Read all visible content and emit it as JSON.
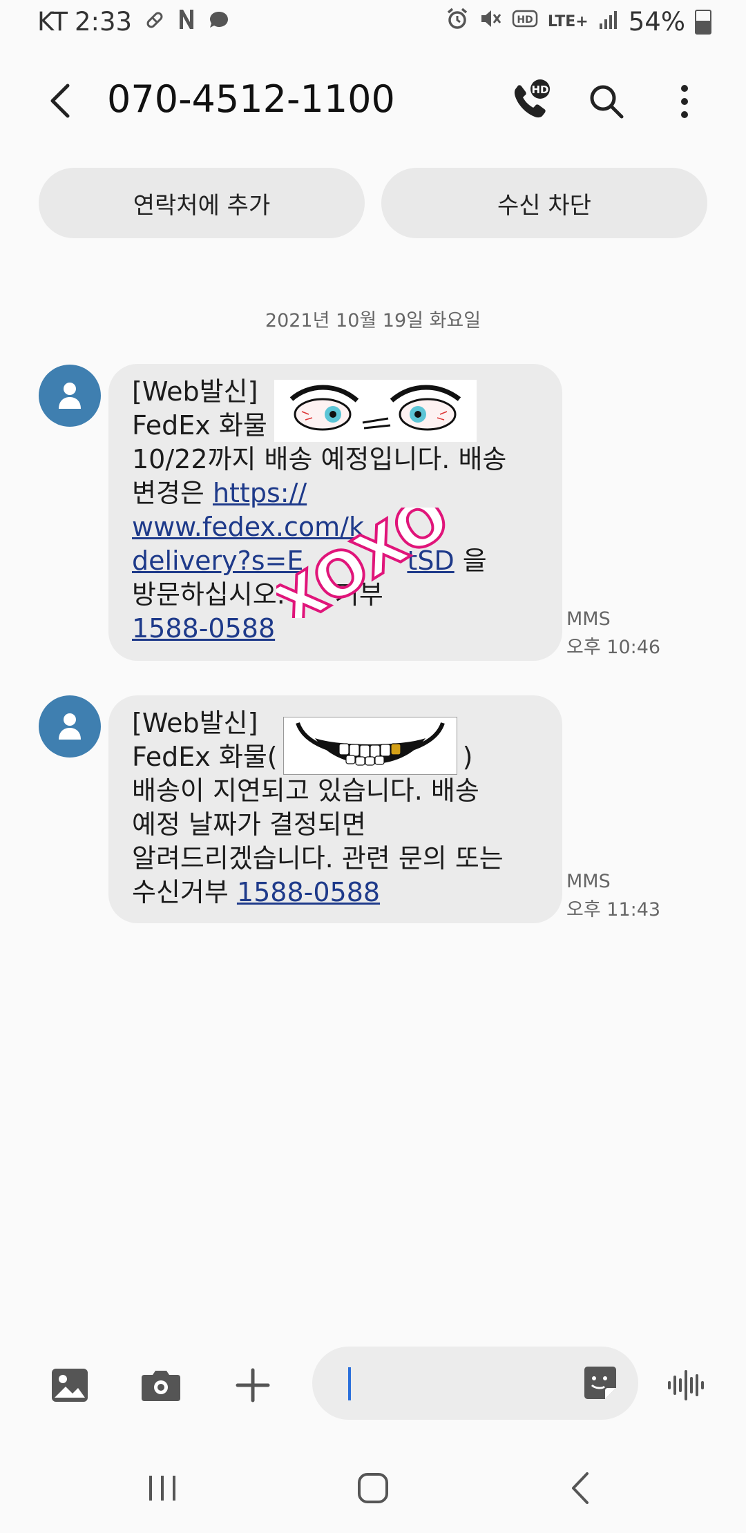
{
  "status_bar": {
    "carrier": "KT",
    "time": "2:33",
    "network": "LTE+",
    "battery": "54%",
    "notification_icons": [
      "pill-icon",
      "n-icon",
      "chat-icon"
    ],
    "system_icons": [
      "alarm-icon",
      "mute-icon",
      "hd-voice-icon",
      "lte-icon",
      "signal-icon",
      "battery-icon"
    ]
  },
  "header": {
    "title": "070-4512-1100",
    "icons": [
      "back-arrow-icon",
      "hd-call-icon",
      "search-icon",
      "more-vert-icon"
    ],
    "hd_badge": "HD"
  },
  "actions": {
    "add_contact": "연락처에 추가",
    "block": "수신 차단"
  },
  "date_separator": "2021년 10월 19일 화요일",
  "messages": [
    {
      "lines": [
        "[Web발신]",
        "FedEx 화물",
        "10/22까지 배송 예정입니다. 배송",
        "변경은 ",
        "https://",
        "www.fedex.com/k",
        "delivery?s=E",
        "tSD",
        " 을",
        "방문하십시오. ",
        "거부",
        "1588-0588"
      ],
      "type": "MMS",
      "time": "오후 10:46",
      "sticker_text": "XOXO"
    },
    {
      "lines": [
        "[Web발신]",
        "FedEx 화물(",
        ")",
        "배송이 지연되고 있습니다. 배송",
        "예정 날짜가 결정되면",
        "알려드리겠습니다. 관련 문의 또는",
        "수신거부 ",
        "1588-0588"
      ],
      "type": "MMS",
      "time": "오후 11:43"
    }
  ],
  "compose": {
    "icons": [
      "gallery-icon",
      "camera-icon",
      "plus-icon",
      "sticker-icon",
      "voice-icon"
    ],
    "value": ""
  },
  "nav": {
    "icons": [
      "recents-icon",
      "home-icon",
      "back-icon"
    ]
  },
  "colors": {
    "background": "#fafafa",
    "bubble": "#ebebeb",
    "avatar": "#3f7fb0",
    "link": "#1e3a8a",
    "xoxo": "#e0157a"
  }
}
